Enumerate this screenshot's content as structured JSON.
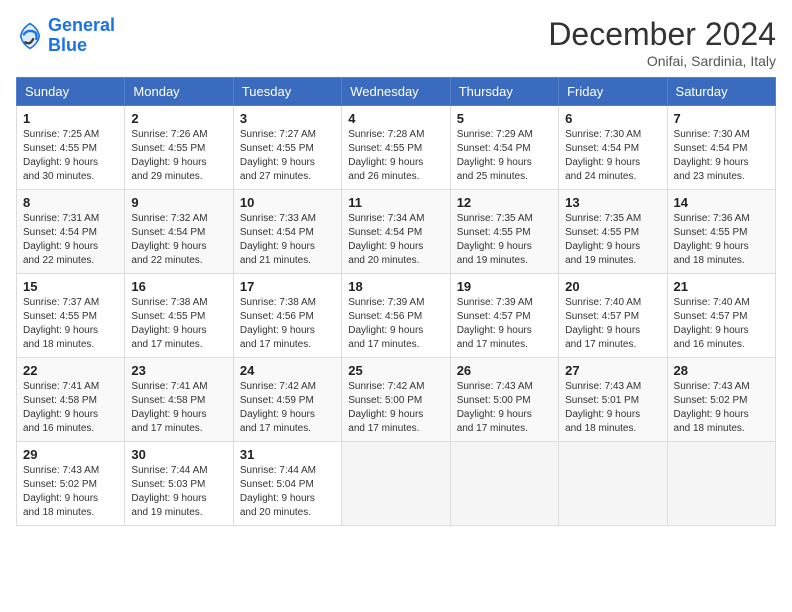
{
  "header": {
    "logo_line1": "General",
    "logo_line2": "Blue",
    "month_title": "December 2024",
    "location": "Onifai, Sardinia, Italy"
  },
  "weekdays": [
    "Sunday",
    "Monday",
    "Tuesday",
    "Wednesday",
    "Thursday",
    "Friday",
    "Saturday"
  ],
  "weeks": [
    [
      {
        "day": "1",
        "info": "Sunrise: 7:25 AM\nSunset: 4:55 PM\nDaylight: 9 hours\nand 30 minutes."
      },
      {
        "day": "2",
        "info": "Sunrise: 7:26 AM\nSunset: 4:55 PM\nDaylight: 9 hours\nand 29 minutes."
      },
      {
        "day": "3",
        "info": "Sunrise: 7:27 AM\nSunset: 4:55 PM\nDaylight: 9 hours\nand 27 minutes."
      },
      {
        "day": "4",
        "info": "Sunrise: 7:28 AM\nSunset: 4:55 PM\nDaylight: 9 hours\nand 26 minutes."
      },
      {
        "day": "5",
        "info": "Sunrise: 7:29 AM\nSunset: 4:54 PM\nDaylight: 9 hours\nand 25 minutes."
      },
      {
        "day": "6",
        "info": "Sunrise: 7:30 AM\nSunset: 4:54 PM\nDaylight: 9 hours\nand 24 minutes."
      },
      {
        "day": "7",
        "info": "Sunrise: 7:30 AM\nSunset: 4:54 PM\nDaylight: 9 hours\nand 23 minutes."
      }
    ],
    [
      {
        "day": "8",
        "info": "Sunrise: 7:31 AM\nSunset: 4:54 PM\nDaylight: 9 hours\nand 22 minutes."
      },
      {
        "day": "9",
        "info": "Sunrise: 7:32 AM\nSunset: 4:54 PM\nDaylight: 9 hours\nand 22 minutes."
      },
      {
        "day": "10",
        "info": "Sunrise: 7:33 AM\nSunset: 4:54 PM\nDaylight: 9 hours\nand 21 minutes."
      },
      {
        "day": "11",
        "info": "Sunrise: 7:34 AM\nSunset: 4:54 PM\nDaylight: 9 hours\nand 20 minutes."
      },
      {
        "day": "12",
        "info": "Sunrise: 7:35 AM\nSunset: 4:55 PM\nDaylight: 9 hours\nand 19 minutes."
      },
      {
        "day": "13",
        "info": "Sunrise: 7:35 AM\nSunset: 4:55 PM\nDaylight: 9 hours\nand 19 minutes."
      },
      {
        "day": "14",
        "info": "Sunrise: 7:36 AM\nSunset: 4:55 PM\nDaylight: 9 hours\nand 18 minutes."
      }
    ],
    [
      {
        "day": "15",
        "info": "Sunrise: 7:37 AM\nSunset: 4:55 PM\nDaylight: 9 hours\nand 18 minutes."
      },
      {
        "day": "16",
        "info": "Sunrise: 7:38 AM\nSunset: 4:55 PM\nDaylight: 9 hours\nand 17 minutes."
      },
      {
        "day": "17",
        "info": "Sunrise: 7:38 AM\nSunset: 4:56 PM\nDaylight: 9 hours\nand 17 minutes."
      },
      {
        "day": "18",
        "info": "Sunrise: 7:39 AM\nSunset: 4:56 PM\nDaylight: 9 hours\nand 17 minutes."
      },
      {
        "day": "19",
        "info": "Sunrise: 7:39 AM\nSunset: 4:57 PM\nDaylight: 9 hours\nand 17 minutes."
      },
      {
        "day": "20",
        "info": "Sunrise: 7:40 AM\nSunset: 4:57 PM\nDaylight: 9 hours\nand 17 minutes."
      },
      {
        "day": "21",
        "info": "Sunrise: 7:40 AM\nSunset: 4:57 PM\nDaylight: 9 hours\nand 16 minutes."
      }
    ],
    [
      {
        "day": "22",
        "info": "Sunrise: 7:41 AM\nSunset: 4:58 PM\nDaylight: 9 hours\nand 16 minutes."
      },
      {
        "day": "23",
        "info": "Sunrise: 7:41 AM\nSunset: 4:58 PM\nDaylight: 9 hours\nand 17 minutes."
      },
      {
        "day": "24",
        "info": "Sunrise: 7:42 AM\nSunset: 4:59 PM\nDaylight: 9 hours\nand 17 minutes."
      },
      {
        "day": "25",
        "info": "Sunrise: 7:42 AM\nSunset: 5:00 PM\nDaylight: 9 hours\nand 17 minutes."
      },
      {
        "day": "26",
        "info": "Sunrise: 7:43 AM\nSunset: 5:00 PM\nDaylight: 9 hours\nand 17 minutes."
      },
      {
        "day": "27",
        "info": "Sunrise: 7:43 AM\nSunset: 5:01 PM\nDaylight: 9 hours\nand 18 minutes."
      },
      {
        "day": "28",
        "info": "Sunrise: 7:43 AM\nSunset: 5:02 PM\nDaylight: 9 hours\nand 18 minutes."
      }
    ],
    [
      {
        "day": "29",
        "info": "Sunrise: 7:43 AM\nSunset: 5:02 PM\nDaylight: 9 hours\nand 18 minutes."
      },
      {
        "day": "30",
        "info": "Sunrise: 7:44 AM\nSunset: 5:03 PM\nDaylight: 9 hours\nand 19 minutes."
      },
      {
        "day": "31",
        "info": "Sunrise: 7:44 AM\nSunset: 5:04 PM\nDaylight: 9 hours\nand 20 minutes."
      },
      null,
      null,
      null,
      null
    ]
  ]
}
